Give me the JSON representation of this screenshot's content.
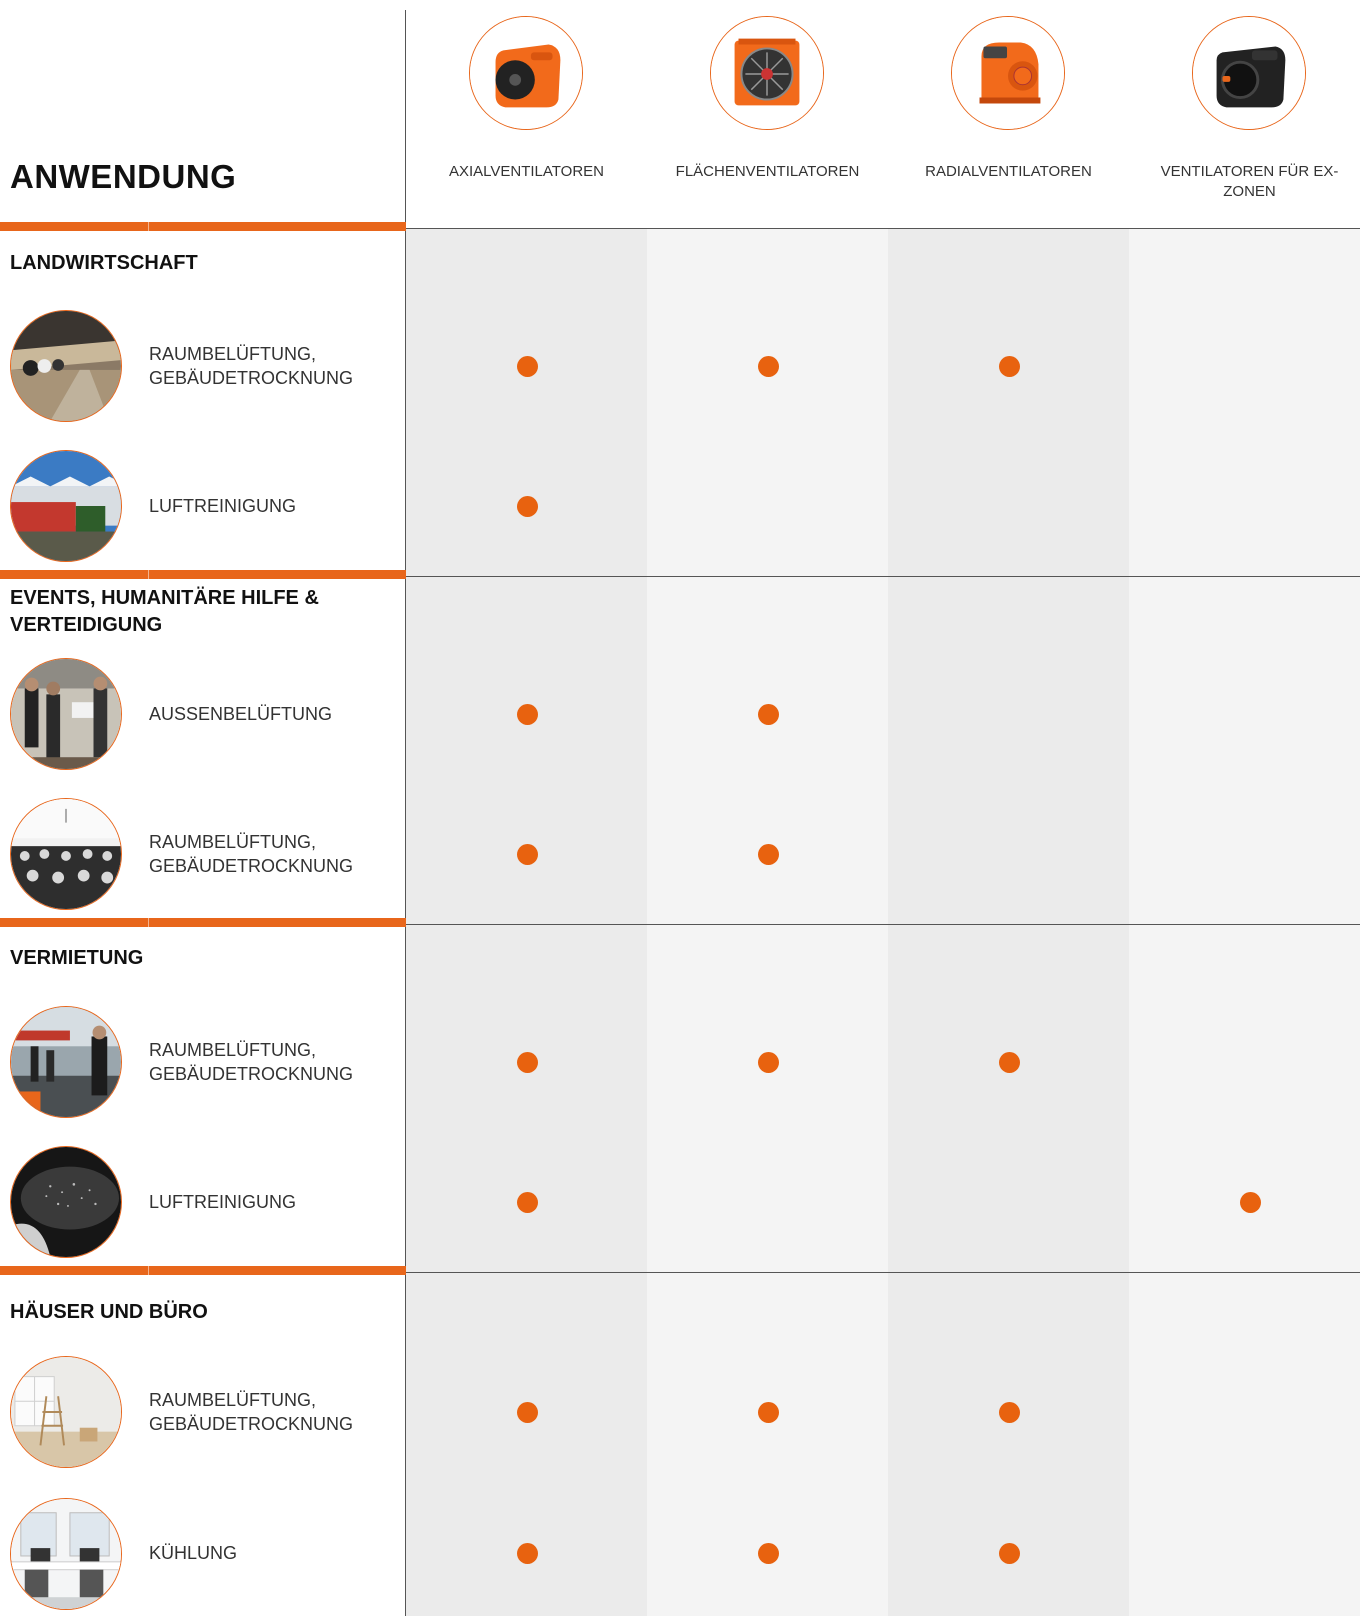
{
  "title": "ANWENDUNG",
  "accent_color": "#e8661b",
  "products": [
    {
      "label": "AXIALVENTILATOREN",
      "icon": "axial-fan-icon"
    },
    {
      "label": "FLÄCHENVENTILATOREN",
      "icon": "area-fan-icon"
    },
    {
      "label": "RADIALVENTILATOREN",
      "icon": "radial-blower-icon"
    },
    {
      "label": "VENTILATOREN FÜR EX-ZONEN",
      "icon": "ex-zone-fan-icon"
    }
  ],
  "sections": [
    {
      "title": "LANDWIRTSCHAFT",
      "rows": [
        {
          "label": "RAUMBELÜFTUNG, GEBÄUDETROCKNUNG",
          "image": "barn-photo",
          "marks": [
            true,
            true,
            true,
            false
          ]
        },
        {
          "label": "LUFTREINIGUNG",
          "image": "greenhouse-photo",
          "marks": [
            true,
            false,
            false,
            false
          ]
        }
      ]
    },
    {
      "title": "EVENTS, HUMANITÄRE HILFE & VERTEIDIGUNG",
      "rows": [
        {
          "label": "AUSSENBELÜFTUNG",
          "image": "event-people-photo",
          "marks": [
            true,
            true,
            false,
            false
          ]
        },
        {
          "label": "RAUMBELÜFTUNG, GEBÄUDETROCKNUNG",
          "image": "event-hall-photo",
          "marks": [
            true,
            true,
            false,
            false
          ]
        }
      ]
    },
    {
      "title": "VERMIETUNG",
      "rows": [
        {
          "label": "RAUMBELÜFTUNG, GEBÄUDETROCKNUNG",
          "image": "rental-hall-photo",
          "marks": [
            true,
            true,
            true,
            false
          ]
        },
        {
          "label": "LUFTREINIGUNG",
          "image": "dust-photo",
          "marks": [
            true,
            false,
            false,
            true
          ]
        }
      ]
    },
    {
      "title": "HÄUSER UND BÜRO",
      "rows": [
        {
          "label": "RAUMBELÜFTUNG, GEBÄUDETROCKNUNG",
          "image": "empty-room-photo",
          "marks": [
            true,
            true,
            true,
            false
          ]
        },
        {
          "label": "KÜHLUNG",
          "image": "office-photo",
          "marks": [
            true,
            true,
            true,
            false
          ]
        }
      ]
    }
  ]
}
